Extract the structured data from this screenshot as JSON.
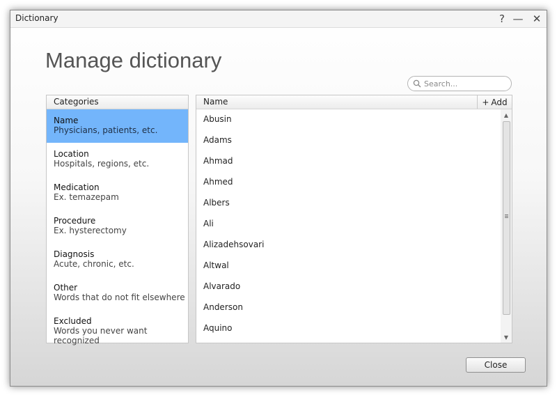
{
  "window": {
    "title": "Dictionary",
    "help_label": "?",
    "minimize_label": "—",
    "close_label": "✕"
  },
  "page": {
    "heading": "Manage dictionary"
  },
  "search": {
    "placeholder": "Search...",
    "value": ""
  },
  "categories": {
    "header": "Categories",
    "selected_index": 0,
    "items": [
      {
        "title": "Name",
        "subtitle": "Physicians, patients, etc."
      },
      {
        "title": "Location",
        "subtitle": "Hospitals, regions, etc."
      },
      {
        "title": "Medication",
        "subtitle": "Ex. temazepam"
      },
      {
        "title": "Procedure",
        "subtitle": "Ex. hysterectomy"
      },
      {
        "title": "Diagnosis",
        "subtitle": "Acute, chronic, etc."
      },
      {
        "title": "Other",
        "subtitle": "Words that do not fit elsewhere"
      },
      {
        "title": "Excluded",
        "subtitle": "Words you never want recognized"
      }
    ]
  },
  "names": {
    "header": "Name",
    "add_label": "Add",
    "add_icon": "plus-icon",
    "items": [
      "Abusin",
      "Adams",
      "Ahmad",
      "Ahmed",
      "Albers",
      "Ali",
      "Alizadehsovari",
      "Altwal",
      "Alvarado",
      "Anderson",
      "Aquino"
    ]
  },
  "footer": {
    "close_label": "Close"
  },
  "colors": {
    "selection": "#73b5fb",
    "heading": "#555555"
  }
}
